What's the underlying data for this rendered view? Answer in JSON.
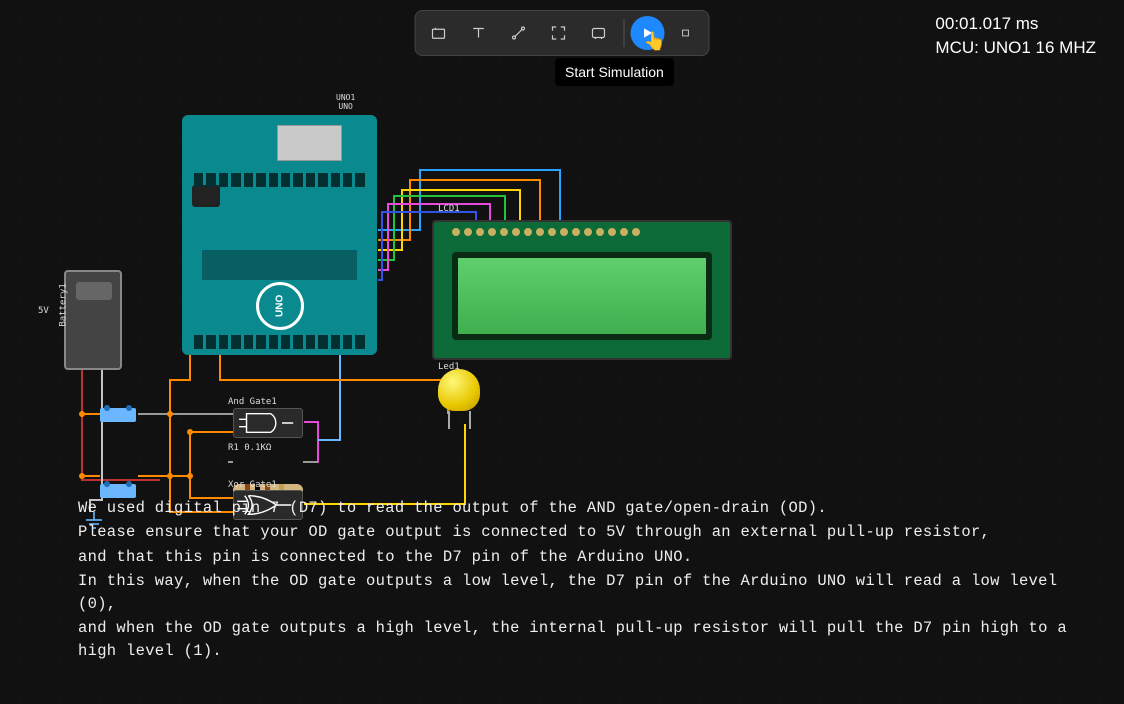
{
  "toolbar": {
    "tooltip_start": "Start Simulation"
  },
  "status": {
    "time": "00:01.017 ms",
    "mcu": "MCU: UNO1 16 MHZ"
  },
  "components": {
    "arduino_name": "UNO1",
    "arduino_sub": "UNO",
    "arduino_logo": "UNO",
    "lcd_label": "LCD1",
    "led_label": "Led1",
    "battery_label": "Battery1",
    "battery_v": "5V",
    "and_label": "And Gate1",
    "xor_label": "Xor Gate1",
    "resistor_label": "R1  0.1KΩ"
  },
  "help": {
    "l1": "We used digital pin 7 (D7) to read the output of the AND gate/open-drain (OD).",
    "l2": "Please ensure that your OD gate output is connected to 5V through an external pull-up resistor,",
    "l3": "and that this pin is connected to the D7 pin of the Arduino UNO.",
    "l4": "In this way, when the OD gate outputs a low level, the D7 pin of the Arduino UNO will read a low level (0),",
    "l5": "and when the OD gate outputs a high level, the internal pull-up resistor will pull the D7 pin high to a high level (1)."
  }
}
